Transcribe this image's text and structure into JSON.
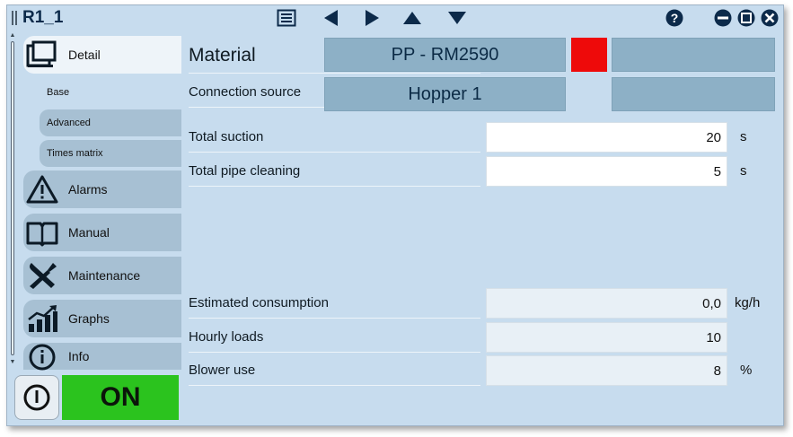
{
  "window": {
    "title": "R1_1"
  },
  "toolbar": {
    "icons": [
      "list-icon",
      "arrow-left-icon",
      "arrow-right-icon",
      "arrow-up-icon",
      "arrow-down-icon",
      "help-icon",
      "minimize-icon",
      "maximize-icon",
      "close-icon"
    ]
  },
  "sidebar": {
    "main_items": [
      {
        "label": "Detail",
        "icon": "detail-icon",
        "active": true
      },
      {
        "label": "Alarms",
        "icon": "alarm-icon"
      },
      {
        "label": "Manual",
        "icon": "book-icon"
      },
      {
        "label": "Maintenance",
        "icon": "tools-icon"
      },
      {
        "label": "Graphs",
        "icon": "graph-icon"
      },
      {
        "label": "Info",
        "icon": "info-icon"
      }
    ],
    "sub_items": [
      {
        "label": "Base",
        "active": true
      },
      {
        "label": "Advanced"
      },
      {
        "label": "Times matrix"
      }
    ],
    "status": "ON"
  },
  "colors": {
    "status_on": "#2bc31e",
    "material_color": "#ee0a0a",
    "accent_box": "#8db0c6"
  },
  "main": {
    "material": {
      "label": "Material",
      "value": "PP - RM2590"
    },
    "connection": {
      "label": "Connection source",
      "value": "Hopper 1"
    },
    "fields": [
      {
        "label": "Total suction",
        "value": "20",
        "unit": "s",
        "editable": true
      },
      {
        "label": "Total pipe  cleaning",
        "value": "5",
        "unit": "s",
        "editable": true
      },
      {
        "label": "Estimated consumption",
        "value": "0,0",
        "unit": "kg/h",
        "editable": false
      },
      {
        "label": "Hourly loads",
        "value": "10",
        "unit": "",
        "editable": false
      },
      {
        "label": "Blower use",
        "value": "8",
        "unit": "%",
        "editable": false
      }
    ]
  }
}
